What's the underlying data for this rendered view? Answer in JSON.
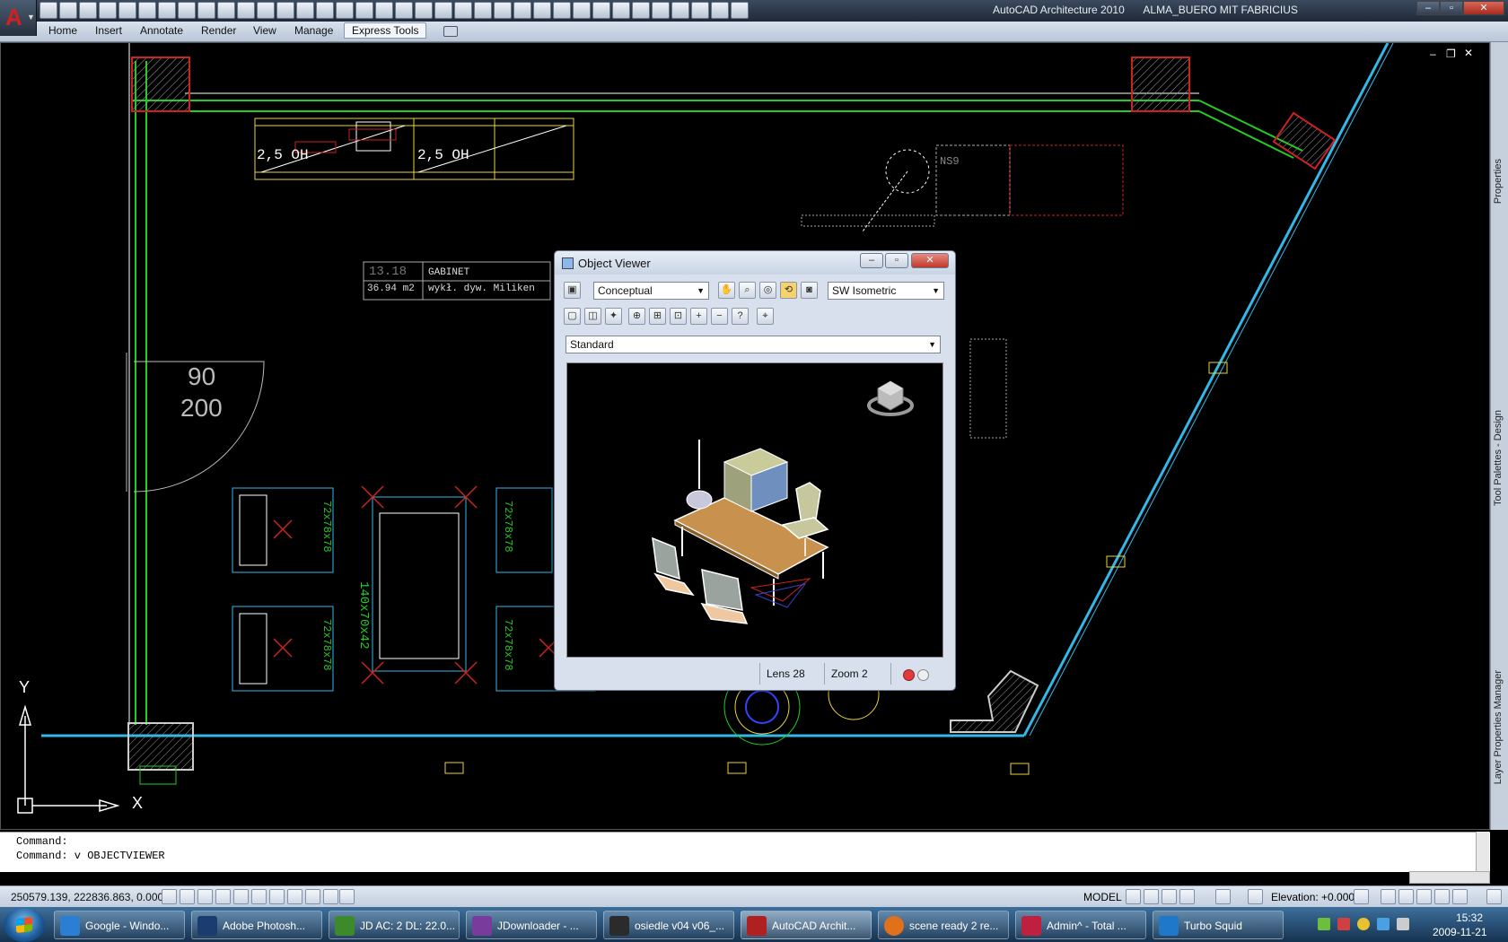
{
  "app": {
    "title": "AutoCAD Architecture 2010",
    "document": "ALMA_BUERO MIT FABRICIUS"
  },
  "menu": {
    "tabs": [
      {
        "label": "Home"
      },
      {
        "label": "Insert"
      },
      {
        "label": "Annotate"
      },
      {
        "label": "Render"
      },
      {
        "label": "View"
      },
      {
        "label": "Manage"
      },
      {
        "label": "Express Tools",
        "active": true
      }
    ]
  },
  "drawing": {
    "room_number": "13.18",
    "room_name": "GABINET",
    "room_area": "36.94 m2",
    "room_finish": "wykł. dyw. Miliken",
    "door_width": "90",
    "door_height": "200",
    "cabinet_label_1": "2,5 OH",
    "cabinet_label_2": "2,5 OH",
    "cabinet_tag": "NS9",
    "table_label": "140x70x42",
    "chair_label": "72x78x78",
    "ucs_y": "Y",
    "ucs_x": "X",
    "colors": {
      "wall_green": "#22cc22",
      "outline_cyan": "#33b8e8",
      "cabinet_yellow": "#e8d23a",
      "hatch_red": "#cc2222"
    }
  },
  "right_palettes": [
    "Properties",
    "Tool Palettes - Design",
    "Layer Properties Manager"
  ],
  "object_viewer": {
    "title": "Object Viewer",
    "visual_style": "Conceptual",
    "view": "SW Isometric",
    "ucs": "Standard",
    "lens": "Lens 28",
    "zoom": "Zoom 2"
  },
  "command_line": {
    "line1": "Command:",
    "line2": "Command: v OBJECTVIEWER"
  },
  "status": {
    "coordinates": "250579.139, 222836.863, 0.000",
    "space": "MODEL",
    "elevation": "Elevation: +0.000"
  },
  "taskbar": {
    "items": [
      {
        "label": "Google - Windo...",
        "color": "#2a7fd4"
      },
      {
        "label": "Adobe Photosh...",
        "color": "#1b3c6e"
      },
      {
        "label": "JD AC: 2 DL: 22.0...",
        "color": "#3c8a2c"
      },
      {
        "label": "JDownloader - ...",
        "color": "#7a3c9c"
      },
      {
        "label": "osiedle v04 v06_...",
        "color": "#2b2b2b"
      },
      {
        "label": "AutoCAD Archit...",
        "color": "#b02020",
        "active": true
      },
      {
        "label": "scene ready 2 re...",
        "color": "#e0701a"
      },
      {
        "label": "Admin^ - Total ...",
        "color": "#c02040"
      },
      {
        "label": "Turbo Squid",
        "color": "#1f78c8"
      }
    ],
    "time": "15:32",
    "date": "2009-11-21"
  }
}
